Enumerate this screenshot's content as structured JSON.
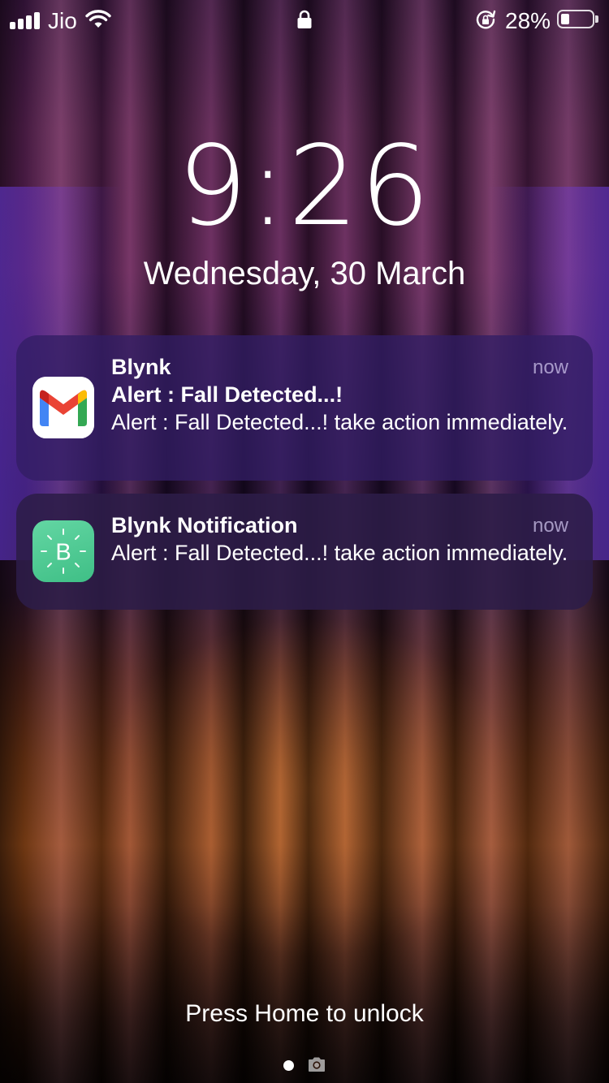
{
  "status_bar": {
    "carrier": "Jio",
    "battery_percent": "28%",
    "battery_level": 0.28,
    "icons": [
      "signal-icon",
      "wifi-icon",
      "lock-icon",
      "rotation-lock-icon",
      "battery-icon"
    ]
  },
  "lock_screen": {
    "time": "9:26",
    "date": "Wednesday, 30 March",
    "unlock_hint": "Press Home to unlock"
  },
  "notifications": [
    {
      "app": "Blynk",
      "title": "Alert : Fall Detected...!",
      "body": "Alert : Fall Detected...! take action immediately.",
      "time": "now",
      "icon": "gmail-icon"
    },
    {
      "app": "Blynk Notification",
      "body": "Alert : Fall Detected...! take action immediately.",
      "time": "now",
      "icon": "blynk-icon"
    }
  ],
  "colors": {
    "notification_bg": "#2c1c4e",
    "blynk_green": "#4fcb93",
    "gmail_red": "#ea4335",
    "gmail_blue": "#4285f4",
    "gmail_green": "#34a853",
    "gmail_yellow": "#fbbc05"
  }
}
